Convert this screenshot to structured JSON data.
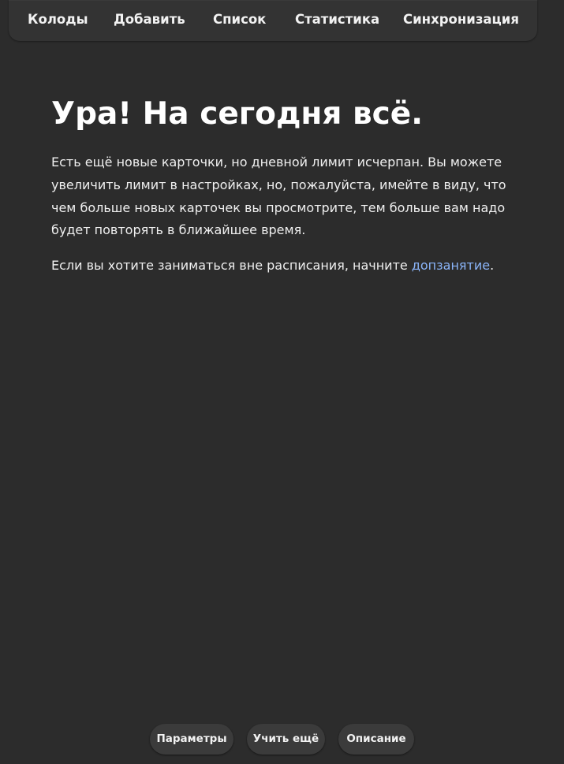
{
  "nav": {
    "items": [
      {
        "label": "Колоды"
      },
      {
        "label": "Добавить"
      },
      {
        "label": "Список"
      },
      {
        "label": "Статистика"
      },
      {
        "label": "Синхронизация"
      }
    ]
  },
  "main": {
    "heading": "Ура! На сегодня всё.",
    "paragraph": "Есть ещё новые карточки, но дневной лимит исчерпан. Вы можете увеличить лимит в настройках, но, пожалуйста, имейте в виду, что чем больше новых карточек вы просмотрите, тем больше вам надо будет повторять в ближайшее время.",
    "custom_study_prefix": "Если вы хотите заниматься вне расписания, начните ",
    "custom_study_link": "допзанятие",
    "custom_study_suffix": "."
  },
  "bottom": {
    "options_label": "Параметры",
    "study_more_label": "Учить ещё",
    "description_label": "Описание"
  },
  "colors": {
    "background": "#2c2c2c",
    "topbar": "#333333",
    "button": "#3b3b3b",
    "link": "#8ab4f8"
  }
}
